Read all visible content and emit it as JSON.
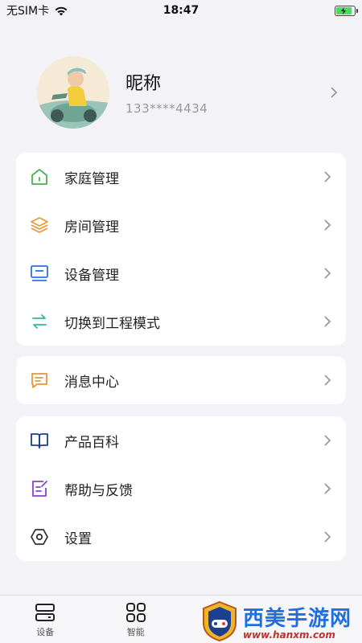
{
  "status_bar": {
    "carrier": "无SIM卡",
    "time": "18:47",
    "wifi_icon": "wifi-icon",
    "battery_icon": "battery-charging-icon",
    "battery_level": 0.85
  },
  "profile": {
    "nickname": "昵称",
    "phone": "133****4434",
    "avatar_icon": "user-avatar-illustration"
  },
  "menu_groups": [
    [
      {
        "label": "家庭管理",
        "icon": "home-icon",
        "color": "#4caf50"
      },
      {
        "label": "房间管理",
        "icon": "layers-icon",
        "color": "#e8963a"
      },
      {
        "label": "设备管理",
        "icon": "monitor-icon",
        "color": "#2f6fe0"
      },
      {
        "label": "切换到工程模式",
        "icon": "switch-arrows-icon",
        "color": "#32b6a0"
      }
    ],
    [
      {
        "label": "消息中心",
        "icon": "message-icon",
        "color": "#e8963a"
      }
    ],
    [
      {
        "label": "产品百科",
        "icon": "book-icon",
        "color": "#1d3f8a"
      },
      {
        "label": "帮助与反馈",
        "icon": "feedback-icon",
        "color": "#8a3fd1"
      },
      {
        "label": "设置",
        "icon": "settings-hexagon-icon",
        "color": "#333333"
      }
    ]
  ],
  "tabbar": {
    "tabs": [
      {
        "label": "设备",
        "icon": "devices-icon"
      },
      {
        "label": "智能",
        "icon": "grid-icon"
      }
    ]
  },
  "watermark": {
    "title": "西美手游网",
    "url": "www.hanxm.com"
  }
}
